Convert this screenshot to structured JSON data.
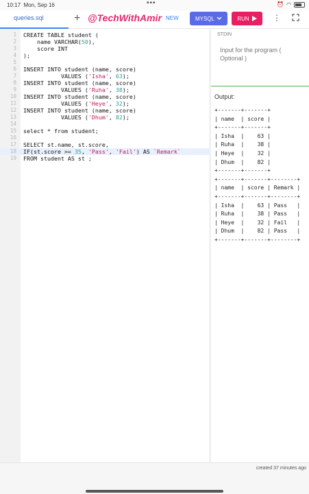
{
  "status_bar": {
    "time": "10:17",
    "date": "Mon, Sep 16",
    "battery": ""
  },
  "toolbar": {
    "tab_label": "queries.sql",
    "watermark": "@TechWithAmir",
    "new_badge": "NEW",
    "db_label": "MYSQL",
    "run_label": "RUN"
  },
  "editor": {
    "lines": [
      "CREATE TABLE student (",
      "    name VARCHAR(50),",
      "    score INT",
      ");",
      "",
      "INSERT INTO student (name, score)",
      "           VALUES ('Isha', 63);",
      "INSERT INTO student (name, score)",
      "           VALUES ('Ruha', 38);",
      "INSERT INTO student (name, score)",
      "           VALUES ('Heye', 32);",
      "INSERT INTO student (name, score)",
      "           VALUES ('Dhum', 82);",
      "",
      "select * from student;",
      "",
      "SELECT st.name, st.score,",
      "IF(st.score >= 35, 'Pass', 'Fail') AS `Remark`",
      "FROM student AS st ;"
    ],
    "active_line": 18
  },
  "stdin": {
    "label": "STDIN",
    "placeholder": "Input for the program ( Optional )"
  },
  "output": {
    "label": "Output:",
    "text": "+-------+-------+\n| name  | score |\n+-------+-------+\n| Isha  |    63 |\n| Ruha  |    38 |\n| Heye  |    32 |\n| Dhum  |    82 |\n+-------+-------+\n+-------+-------+--------+\n| name  | score | Remark |\n+-------+-------+--------+\n| Isha  |    63 | Pass   |\n| Ruha  |    38 | Pass   |\n| Heye  |    32 | Fail   |\n| Dhum  |    82 | Pass   |\n+-------+-------+--------+"
  },
  "footer": {
    "text": "created 37 minutes ago"
  }
}
